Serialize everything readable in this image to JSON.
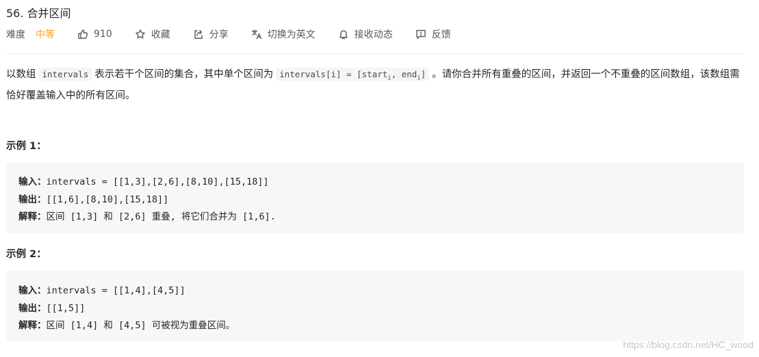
{
  "problem": {
    "title": "56. 合并区间"
  },
  "meta": {
    "difficulty_label": "难度",
    "difficulty_value": "中等",
    "likes": "910",
    "favorite": "收藏",
    "share": "分享",
    "switch_lang": "切换为英文",
    "notifications": "接收动态",
    "feedback": "反馈"
  },
  "colors": {
    "difficulty": "#ffa116",
    "code_bg": "#f7f7f8"
  },
  "description": {
    "part1": "以数组",
    "code1": "intervals",
    "part2": "表示若干个区间的集合，其中单个区间为",
    "code2_a": "intervals[i] = [start",
    "code2_sub1": "i",
    "code2_b": ", end",
    "code2_sub2": "i",
    "code2_c": "]",
    "part3": "。请你合并所有重叠的区间，并返回一个不重叠的区间数组，该数组需恰好覆盖输入中的所有区间。"
  },
  "examples": [
    {
      "title": "示例 1：",
      "input_label": "输入：",
      "input": "intervals = [[1,3],[2,6],[8,10],[15,18]]",
      "output_label": "输出：",
      "output": "[[1,6],[8,10],[15,18]]",
      "explain_label": "解释：",
      "explain": "区间 [1,3] 和 [2,6] 重叠, 将它们合并为 [1,6]."
    },
    {
      "title": "示例 2：",
      "input_label": "输入：",
      "input": "intervals = [[1,4],[4,5]]",
      "output_label": "输出：",
      "output": "[[1,5]]",
      "explain_label": "解释：",
      "explain": "区间 [1,4] 和 [4,5] 可被视为重叠区间。"
    }
  ],
  "watermark": "https://blog.csdn.net/HC_wood"
}
